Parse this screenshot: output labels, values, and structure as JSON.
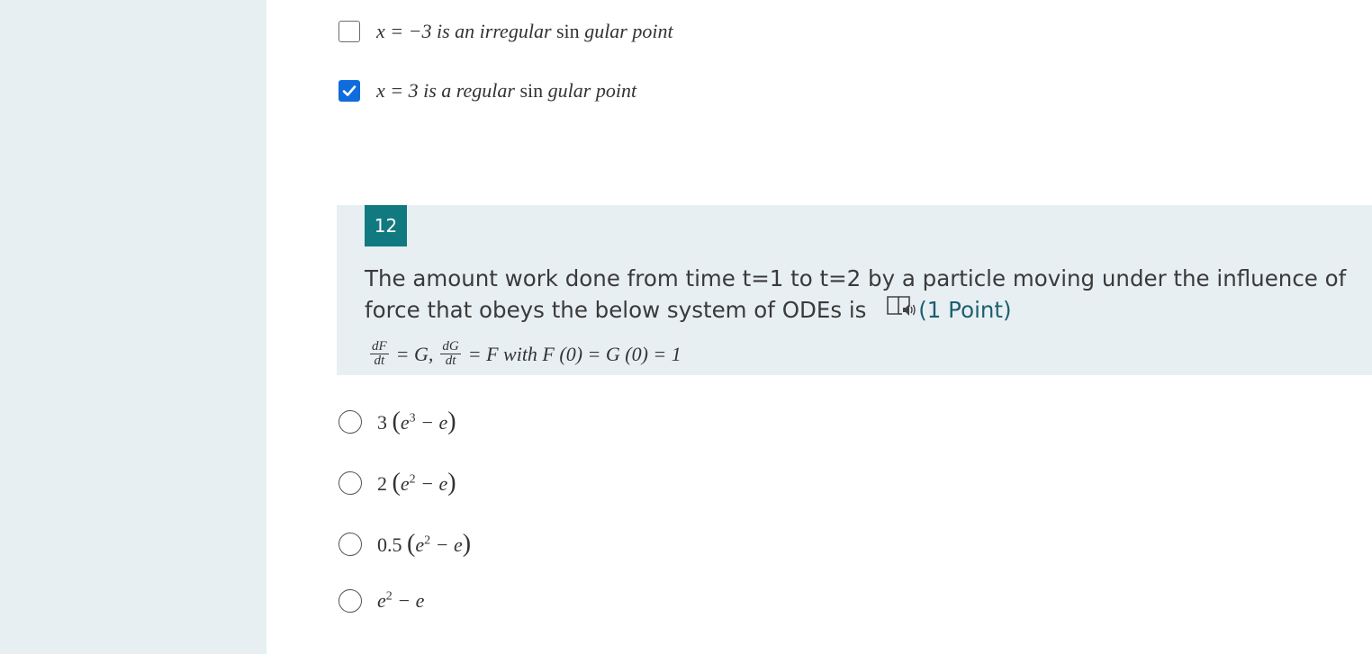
{
  "prev_question": {
    "options": [
      {
        "pre": "x = −3",
        "mid": "is an irregular",
        "sin": "sin",
        "post": "gular point",
        "checked": false
      },
      {
        "pre": "x = 3",
        "mid": "is a regular",
        "sin": "sin",
        "post": "gular point",
        "checked": true
      }
    ]
  },
  "question": {
    "number": "12",
    "text": "The amount work done from time t=1 to t=2 by a particle moving under the influence of force that obeys the below system of ODEs is",
    "points": "(1 Point)",
    "equation": {
      "frac1_num": "dF",
      "frac1_den": "dt",
      "part1": "= G,",
      "frac2_num": "dG",
      "frac2_den": "dt",
      "part2": "= F with F (0) = G (0) = 1"
    }
  },
  "options": [
    {
      "coef": "3",
      "base": "e",
      "exp": "3",
      "tail": "− e"
    },
    {
      "coef": "2",
      "base": "e",
      "exp": "2",
      "tail": "− e"
    },
    {
      "coef": "0.5",
      "base": "e",
      "exp": "2",
      "tail": "− e"
    },
    {
      "coef": "",
      "base": "e",
      "exp": "2",
      "tail": "− e"
    }
  ]
}
